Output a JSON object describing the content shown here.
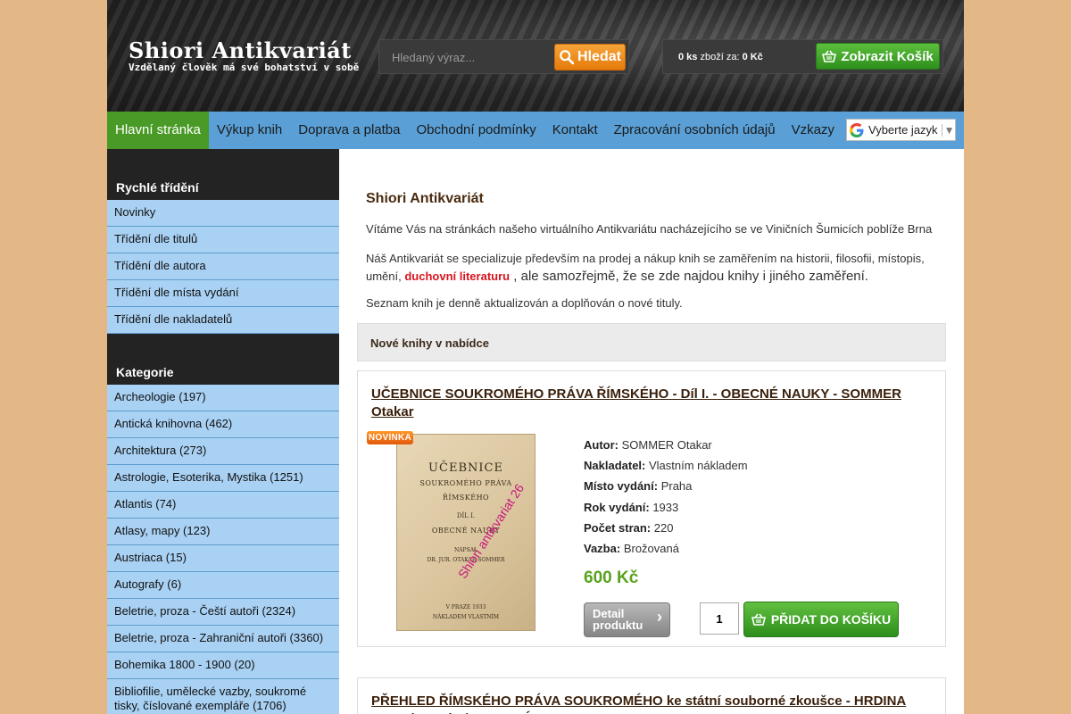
{
  "header": {
    "logo_title": "Shiori Antikvariát",
    "logo_subtitle": "Vzdělaný člověk má své bohatství v sobě",
    "search_placeholder": "Hledaný výraz...",
    "search_button": "Hledat",
    "cart_count": "0 ks",
    "cart_mid": " zboží za: ",
    "cart_total": "0 Kč",
    "cart_button": "Zobrazit Košík"
  },
  "nav": {
    "items": [
      "Hlavní stránka",
      "Výkup knih",
      "Doprava a platba",
      "Obchodní podmínky",
      "Kontakt",
      "Zpracování osobních údajů",
      "Vzkazy"
    ],
    "active_index": 0,
    "language_label": "Vyberte jazyk",
    "language_arrow": "▼"
  },
  "sidebar": {
    "quick_sort_title": "Rychlé třídění",
    "quick_sort": [
      "Novinky",
      "Třídění dle titulů",
      "Třídění dle autora",
      "Třídění dle místa vydání",
      "Třídění dle nakladatelů"
    ],
    "categories_title": "Kategorie",
    "categories": [
      "Archeologie (197)",
      "Antická knihovna (462)",
      "Architektura (273)",
      "Astrologie, Esoterika, Mystika (1251)",
      "Atlantis (74)",
      "Atlasy, mapy (123)",
      "Austriaca (15)",
      "Autografy (6)",
      "Beletrie, proza - Čeští autoři (2324)",
      "Beletrie, proza - Zahraniční autoři (3360)",
      "Bohemika 1800 - 1900 (20)",
      "Bibliofilie, umělecké vazby, soukromé tisky, číslované exempláře (1706)"
    ]
  },
  "main": {
    "title": "Shiori Antikvariát",
    "p1": "Vítáme Vás na stránkách našeho virtuálního Antikvariátu nacházejícího se ve Viničních Šumicích poblíže Brna",
    "p2_start": "Náš Antikvariát se specializuje především na prodej a nákup knih se zaměřením na historii, filosofii, místopis, umění, ",
    "p2_link": "duchovní literaturu",
    "p2_end": " , ale samozřejmě, že se zde najdou knihy i jiného zaměření.",
    "p3": "Seznam knih je denně aktualizován a doplňován o nové tituly.",
    "new_books_header": "Nové knihy v nabídce"
  },
  "products": [
    {
      "title": "UČEBNICE SOUKROMÉHO PRÁVA ŘÍMSKÉHO - Díl I. - OBECNÉ NAUKY - SOMMER Otakar",
      "badge": "NOVINKA",
      "cover_lines": [
        "UČEBNICE",
        "SOUKROMÉHO PRÁVA",
        "ŘÍMSKÉHO",
        "DÍL I.",
        "OBECNÉ NAUKY",
        "NAPSAL",
        "DR. JUR. OTAKAR SOMMER",
        "V PRAZE 1933",
        "NÁKLADEM VLASTNÍM"
      ],
      "watermark": "Shiori antikvariat 26",
      "specs": [
        {
          "label": "Autor:",
          "value": "SOMMER Otakar"
        },
        {
          "label": "Nakladatel:",
          "value": "Vlastním nákladem"
        },
        {
          "label": "Místo vydání:",
          "value": "Praha"
        },
        {
          "label": "Rok vydání:",
          "value": "1933"
        },
        {
          "label": "Počet stran:",
          "value": "220"
        },
        {
          "label": "Vazba:",
          "value": "Brožovaná"
        }
      ],
      "price": "600 Kč",
      "detail_line1": "Detail",
      "detail_line2": "produktu",
      "detail_arrow": "›",
      "quantity": "1",
      "add_button": "PŘIDAT DO KOŠÍKU"
    },
    {
      "title": "PŘEHLED ŘÍMSKÉHO PRÁVA SOUKROMÉHO ke státní souborné zkoušce - HRDINA Antonín Ignác / DOSTALÍK Petr"
    }
  ],
  "colors": {
    "background": "#e3b886",
    "nav": "#5aa0d6",
    "nav_active": "#4a9a27",
    "sidebar_item": "#a9d1f3",
    "price": "#58a21e",
    "accent_red": "#d8141e"
  }
}
